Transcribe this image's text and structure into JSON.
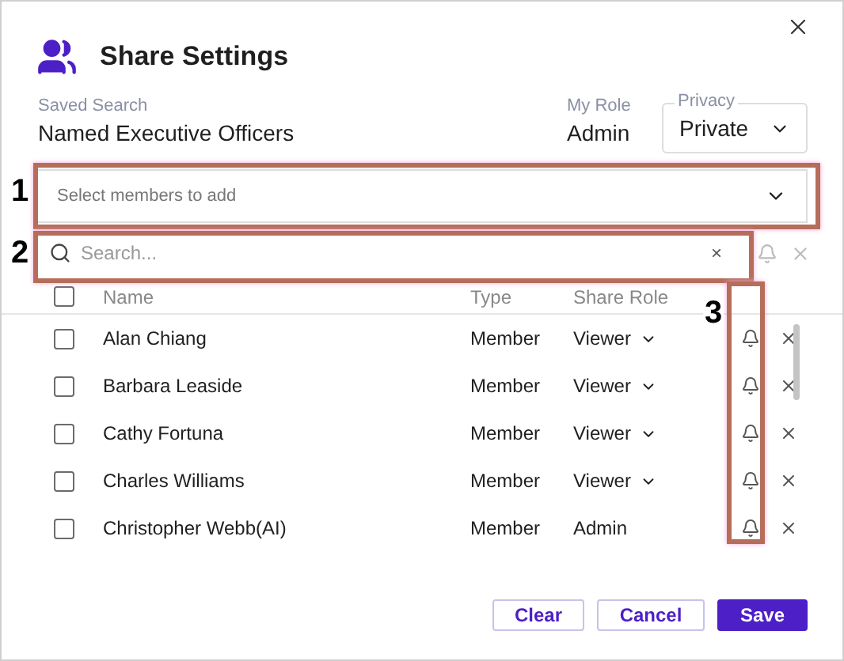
{
  "dialog": {
    "title": "Share Settings"
  },
  "saved_search": {
    "label": "Saved Search",
    "value": "Named Executive Officers"
  },
  "my_role": {
    "label": "My Role",
    "value": "Admin"
  },
  "privacy": {
    "label": "Privacy",
    "value": "Private"
  },
  "member_select": {
    "placeholder": "Select members to add"
  },
  "search": {
    "placeholder": "Search...",
    "clear": "×"
  },
  "table": {
    "columns": [
      "Name",
      "Type",
      "Share Role"
    ],
    "all_checked": false,
    "rows": [
      {
        "name": "Alan Chiang",
        "type": "Member",
        "role": "Viewer",
        "role_dropdown": true,
        "checked": false
      },
      {
        "name": "Barbara Leaside",
        "type": "Member",
        "role": "Viewer",
        "role_dropdown": true,
        "checked": false
      },
      {
        "name": "Cathy Fortuna",
        "type": "Member",
        "role": "Viewer",
        "role_dropdown": true,
        "checked": false
      },
      {
        "name": "Charles Williams",
        "type": "Member",
        "role": "Viewer",
        "role_dropdown": true,
        "checked": false
      },
      {
        "name": "Christopher Webb(AI)",
        "type": "Member",
        "role": "Admin",
        "role_dropdown": false,
        "checked": false
      }
    ]
  },
  "buttons": [
    {
      "label": "Clear",
      "kind": "outline"
    },
    {
      "label": "Cancel",
      "kind": "outline"
    },
    {
      "label": "Save",
      "kind": "primary"
    }
  ],
  "callouts": [
    {
      "label": "1"
    },
    {
      "label": "2"
    },
    {
      "label": "3"
    }
  ]
}
